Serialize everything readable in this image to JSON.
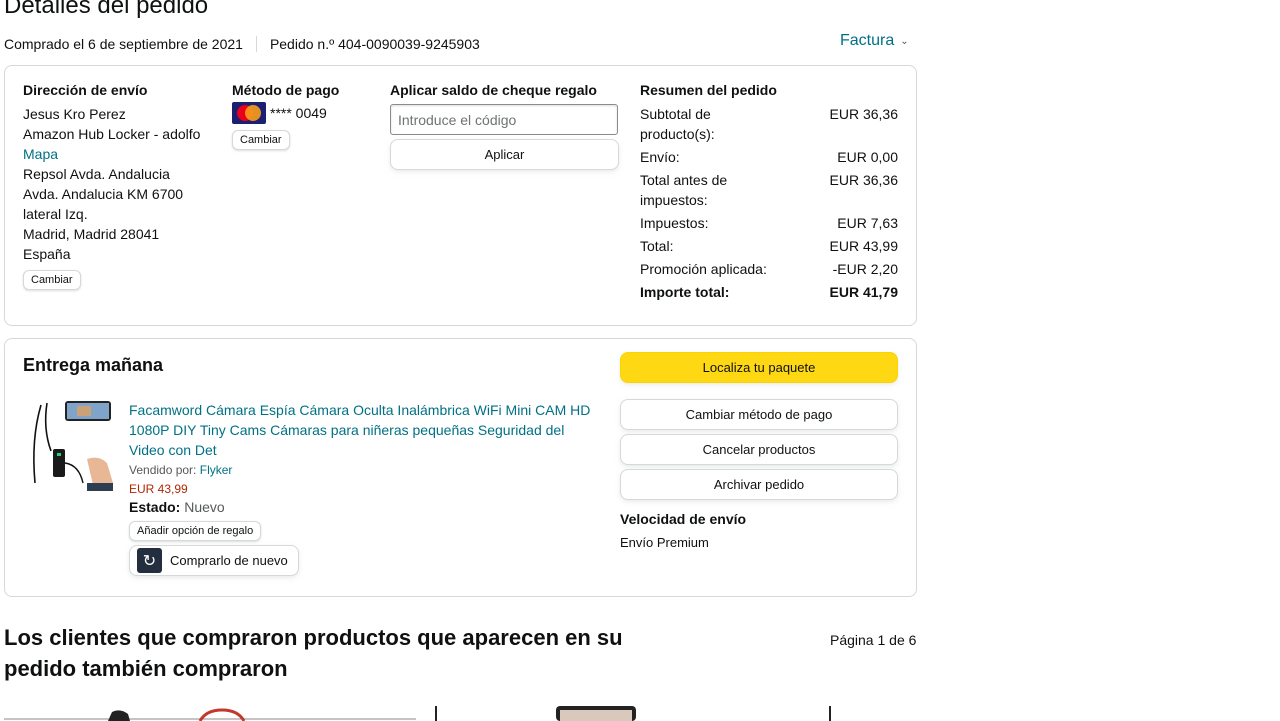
{
  "page": {
    "title": "Detalles del pedido",
    "purchase_date": "Comprado el 6 de septiembre de 2021",
    "order_number": "Pedido n.º 404-0090039-9245903",
    "invoice_label": "Factura"
  },
  "shipping": {
    "heading": "Dirección de envío",
    "name": "Jesus Kro Perez",
    "locker": "Amazon Hub Locker - adolfo",
    "map_link": "Mapa",
    "line1": "Repsol Avda. Andalucia",
    "line2": "Avda. Andalucia KM 6700",
    "line3": "lateral Izq.",
    "city": "Madrid, Madrid 28041",
    "country": "España",
    "change_label": "Cambiar"
  },
  "payment": {
    "heading": "Método de pago",
    "card_mask": "**** 0049",
    "card_icon": "mastercard-icon",
    "change_label": "Cambiar"
  },
  "gift_card": {
    "heading": "Aplicar saldo de cheque regalo",
    "placeholder": "Introduce el código",
    "apply_label": "Aplicar"
  },
  "summary": {
    "heading": "Resumen del pedido",
    "rows": [
      {
        "label": "Subtotal de producto(s):",
        "value": "EUR 36,36"
      },
      {
        "label": "Envío:",
        "value": "EUR 0,00"
      },
      {
        "label": "Total antes de impuestos:",
        "value": "EUR 36,36"
      },
      {
        "label": "Impuestos:",
        "value": "EUR 7,63"
      },
      {
        "label": "Total:",
        "value": "EUR 43,99"
      },
      {
        "label": "Promoción aplicada:",
        "value": "-EUR 2,20"
      }
    ],
    "grand_total_label": "Importe total:",
    "grand_total_value": "EUR 41,79"
  },
  "delivery": {
    "title": "Entrega mañana",
    "product": {
      "title": "Facamword Cámara Espía Cámara Oculta Inalámbrica WiFi Mini CAM HD 1080P DIY Tiny Cams Cámaras para niñeras pequeñas Seguridad del Video con Det",
      "sold_by_label": "Vendido por:",
      "seller": "Flyker",
      "price": "EUR 43,99",
      "state_label": "Estado:",
      "state_value": "Nuevo",
      "gift_option_label": "Añadir opción de regalo",
      "buy_again_label": "Comprarlo de nuevo"
    },
    "actions": {
      "track": "Localiza tu paquete",
      "change_payment": "Cambiar método de pago",
      "cancel": "Cancelar productos",
      "archive": "Archivar pedido"
    },
    "speed_heading": "Velocidad de envío",
    "speed_value": "Envío Premium"
  },
  "recommendations": {
    "title": "Los clientes que compraron productos que aparecen en su pedido también compraron",
    "pagination": "Página 1 de 6"
  },
  "colors": {
    "link": "#007185",
    "price": "#b12704",
    "primary_button": "#ffd814",
    "border": "#d5d9d9"
  }
}
